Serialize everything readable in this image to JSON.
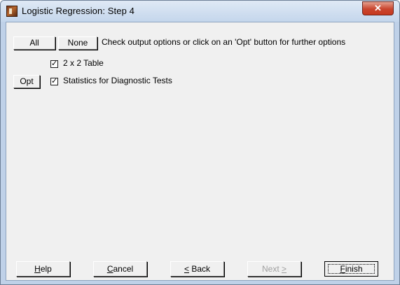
{
  "window": {
    "title": "Logistic Regression: Step 4",
    "close_glyph": "✕"
  },
  "toolbar": {
    "all_label": "All",
    "none_label": "None",
    "instruction": "Check output options or click on an 'Opt' button for further options"
  },
  "options": [
    {
      "label": "2 x 2 Table",
      "checked": true,
      "has_opt": false
    },
    {
      "label": "Statistics for Diagnostic Tests",
      "checked": true,
      "has_opt": true,
      "opt_label": "Opt"
    }
  ],
  "footer": {
    "help": {
      "mnemonic": "H",
      "rest": "elp"
    },
    "cancel": {
      "mnemonic": "C",
      "rest": "ancel"
    },
    "back": {
      "mnemonic": "<",
      "rest": " Back"
    },
    "next": {
      "pre": "Next ",
      "mnemonic": ">"
    },
    "finish": {
      "mnemonic": "F",
      "rest": "inish"
    }
  },
  "colors": {
    "title_bar": "#c4d6ec",
    "close_button": "#c7391f",
    "dialog_bg": "#f0f0f0"
  }
}
